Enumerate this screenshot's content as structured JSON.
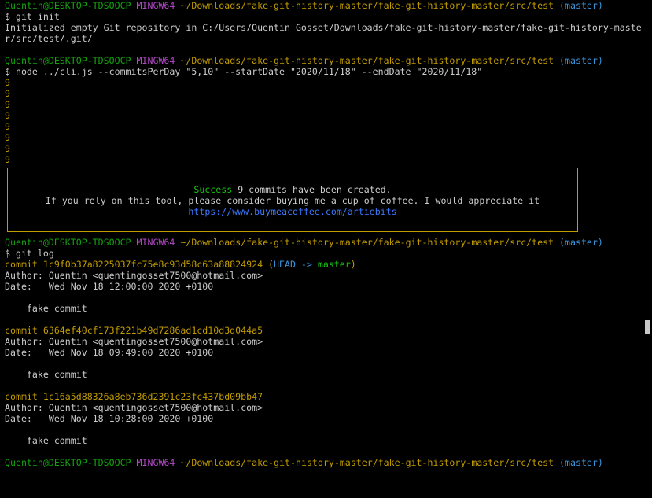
{
  "prompt": {
    "user_host": "Quentin@DESKTOP-TDSOOCP",
    "env": "MINGW64",
    "path": "~/Downloads/fake-git-history-master/fake-git-history-master/src/test",
    "branch": "(master)"
  },
  "session": {
    "cmd1": "$ git init",
    "out1_a": "Initialized empty Git repository in C:/Users/Quentin Gosset/Downloads/fake-git-history-master/fake-git-history-maste",
    "out1_b": "r/src/test/.git/",
    "cmd2": "$ node ../cli.js --commitsPerDay \"5,10\" --startDate \"2020/11/18\" --endDate \"2020/11/18\"",
    "nines": [
      "9",
      "9",
      "9",
      "9",
      "9",
      "9",
      "9",
      "9"
    ],
    "box": {
      "success_word": "Success",
      "success_rest": " 9 commits have been created.",
      "line2": "If you rely on this tool, please consider buying me a cup of coffee. I would appreciate it",
      "link": "https://www.buymeacoffee.com/artiebits"
    },
    "cmd3": "$ git log",
    "commits": [
      {
        "commit": "commit 1c9f0b37a8225037fc75e8c93d58c63a88824924",
        "ref_open": " (",
        "ref_head": "HEAD -> ",
        "ref_branch": "master",
        "ref_close": ")",
        "author": "Author: Quentin <quentingosset7500@hotmail.com>",
        "date": "Date:   Wed Nov 18 12:00:00 2020 +0100",
        "message": "    fake commit"
      },
      {
        "commit": "commit 6364ef40cf173f221b49d7286ad1cd10d3d044a5",
        "author": "Author: Quentin <quentingosset7500@hotmail.com>",
        "date": "Date:   Wed Nov 18 09:49:00 2020 +0100",
        "message": "    fake commit"
      },
      {
        "commit": "commit 1c16a5d88326a8eb736d2391c23fc437bd09bb47",
        "author": "Author: Quentin <quentingosset7500@hotmail.com>",
        "date": "Date:   Wed Nov 18 10:28:00 2020 +0100",
        "message": "    fake commit"
      }
    ]
  },
  "colors": {
    "background": "#000000",
    "text": "#c0c0c0",
    "prompt_user": "#13a10e",
    "prompt_env": "#b148c6",
    "prompt_path": "#c19c00",
    "prompt_branch": "#3a96dd",
    "link": "#3b78ff"
  }
}
